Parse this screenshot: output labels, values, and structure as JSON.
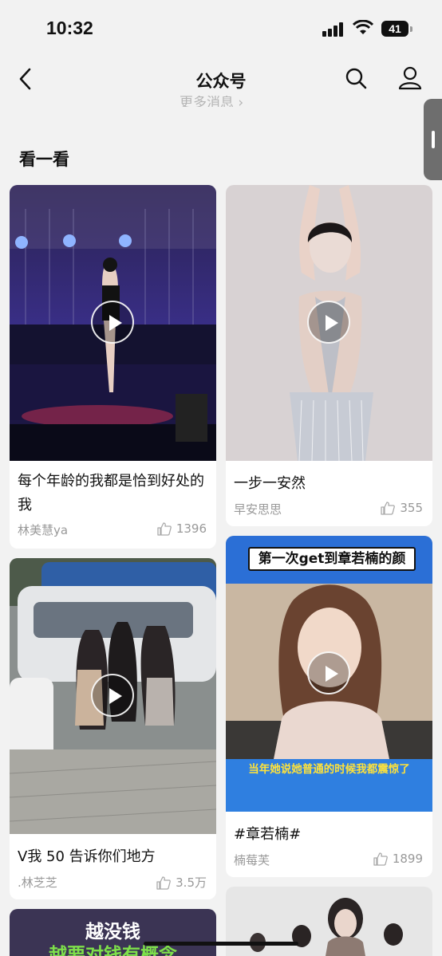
{
  "status": {
    "time": "10:32",
    "battery": "41"
  },
  "nav": {
    "title": "公众号"
  },
  "more_hint": "更多消息 ›",
  "section": {
    "title": "看一看"
  },
  "cards": [
    {
      "title": "每个年龄的我都是恰到好处的我",
      "author": "林美慧ya",
      "likes": "1396"
    },
    {
      "title": "一步一安然",
      "author": "早安思思",
      "likes": "355"
    },
    {
      "title": "V我 50 告诉你们地方",
      "author": ".林芝芝",
      "likes": "3.5万"
    },
    {
      "title": "#章若楠#",
      "author": "楠莓芙",
      "likes": "1899",
      "caption_top": "第一次get到章若楠的颜",
      "caption_bottom": "当年她说她普通的时候我都震惊了"
    },
    {
      "overlay_line1": "越没钱",
      "overlay_line2": "越要对钱有概念"
    }
  ],
  "colors": {
    "accent_stage": "#3a2f8a",
    "caption_blue": "#2b6fd6",
    "caption_yellow": "#ffe23a"
  }
}
